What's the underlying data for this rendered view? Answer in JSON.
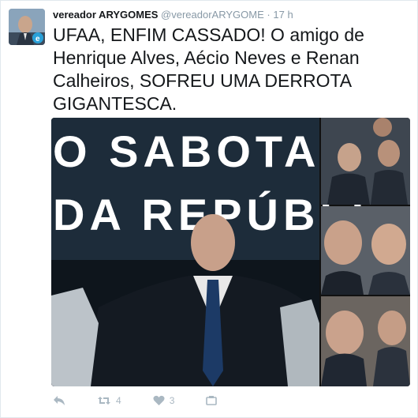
{
  "tweet": {
    "user_name": "vereador ARYGOMES",
    "handle": "@vereadorARYGOME",
    "separator": "·",
    "time": "17 h",
    "text": "UFAA, ENFIM CASSADO! O amigo de Henrique Alves, Aécio Neves e Renan Calheiros, SOFREU UMA DERROTA GIGANTESCA."
  },
  "media": {
    "poster_line1": "O SABOTAD",
    "poster_line2": "DA REPÚBLI"
  },
  "actions": {
    "reply_icon": "reply-icon",
    "retweet_icon": "retweet-icon",
    "retweet_count": "4",
    "like_icon": "heart-icon",
    "like_count": "3",
    "more_icon": "more-icon"
  },
  "colors": {
    "text": "#14171a",
    "muted": "#8899a6",
    "action_gray": "#aab8c2"
  }
}
